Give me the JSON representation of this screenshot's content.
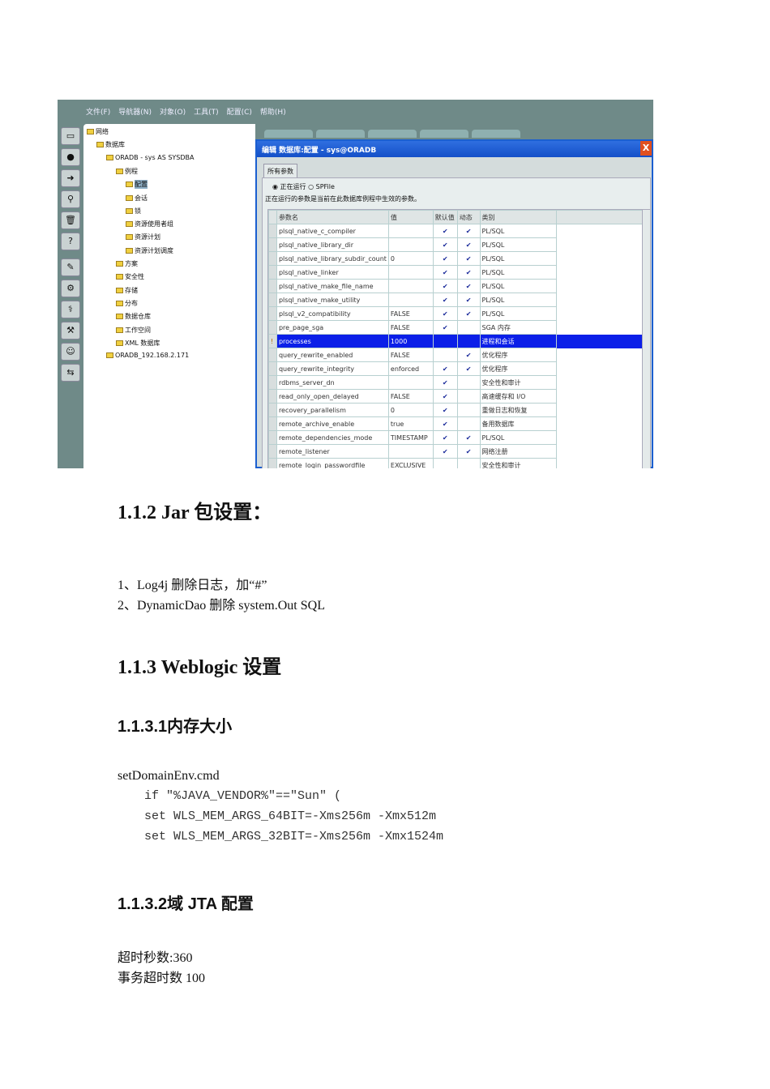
{
  "screenshot": {
    "menu": [
      "文件(F)",
      "导航器(N)",
      "对象(O)",
      "工具(T)",
      "配置(C)",
      "帮助(H)"
    ],
    "tree": [
      {
        "label": "网络",
        "level": 0
      },
      {
        "label": "数据库",
        "level": 1
      },
      {
        "label": "ORADB - sys AS SYSDBA",
        "level": 2
      },
      {
        "label": "例程",
        "level": 3
      },
      {
        "label": "配置",
        "level": 4,
        "selected": true
      },
      {
        "label": "会话",
        "level": 4
      },
      {
        "label": "锁",
        "level": 4
      },
      {
        "label": "资源使用者组",
        "level": 4
      },
      {
        "label": "资源计划",
        "level": 4
      },
      {
        "label": "资源计划调度",
        "level": 4
      },
      {
        "label": "方案",
        "level": 3
      },
      {
        "label": "安全性",
        "level": 3
      },
      {
        "label": "存储",
        "level": 3
      },
      {
        "label": "分布",
        "level": 3
      },
      {
        "label": "数据仓库",
        "level": 3
      },
      {
        "label": "工作空间",
        "level": 3
      },
      {
        "label": "XML 数据库",
        "level": 3
      },
      {
        "label": "ORADB_192.168.2.171",
        "level": 2
      }
    ],
    "dialog": {
      "title": "编辑 数据库:配置 - sys@ORADB",
      "close": "X",
      "tab": "所有参数",
      "radio_running": "正在运行",
      "radio_spfile": "SPFile",
      "description": "正在运行的参数是当前在此数据库例程中生效的参数。",
      "columns": [
        "参数名",
        "值",
        "默认值",
        "动态",
        "类别"
      ],
      "rows": [
        [
          "plsql_native_c_compiler",
          "",
          true,
          true,
          "PL/SQL"
        ],
        [
          "plsql_native_library_dir",
          "",
          true,
          true,
          "PL/SQL"
        ],
        [
          "plsql_native_library_subdir_count",
          "0",
          true,
          true,
          "PL/SQL"
        ],
        [
          "plsql_native_linker",
          "",
          true,
          true,
          "PL/SQL"
        ],
        [
          "plsql_native_make_file_name",
          "",
          true,
          true,
          "PL/SQL"
        ],
        [
          "plsql_native_make_utility",
          "",
          true,
          true,
          "PL/SQL"
        ],
        [
          "plsql_v2_compatibility",
          "FALSE",
          true,
          true,
          "PL/SQL"
        ],
        [
          "pre_page_sga",
          "FALSE",
          true,
          false,
          "SGA 内存"
        ],
        [
          "processes",
          "1000",
          false,
          false,
          "进程和会话"
        ],
        [
          "query_rewrite_enabled",
          "FALSE",
          false,
          true,
          "优化程序"
        ],
        [
          "query_rewrite_integrity",
          "enforced",
          true,
          true,
          "优化程序"
        ],
        [
          "rdbms_server_dn",
          "",
          true,
          false,
          "安全性和审计"
        ],
        [
          "read_only_open_delayed",
          "FALSE",
          true,
          false,
          "高速缓存和 I/O"
        ],
        [
          "recovery_parallelism",
          "0",
          true,
          false,
          "重做日志和恢复"
        ],
        [
          "remote_archive_enable",
          "true",
          true,
          false,
          "备用数据库"
        ],
        [
          "remote_dependencies_mode",
          "TIMESTAMP",
          true,
          true,
          "PL/SQL"
        ],
        [
          "remote_listener",
          "",
          true,
          true,
          "网络注册"
        ],
        [
          "remote_login_passwordfile",
          "EXCLUSIVE",
          false,
          false,
          "安全性和审计"
        ]
      ],
      "selected_row": 8
    }
  },
  "doc": {
    "h_112": "1.1.2 Jar 包设置：",
    "item1": "1、Log4j 删除日志，加“#”",
    "item2": "2、DynamicDao 删除 system.Out SQL",
    "h_113": "1.1.3 Weblogic 设置",
    "h_1131": "1.1.3.1内存大小",
    "file": "setDomainEnv.cmd",
    "code": [
      "if \"%JAVA_VENDOR%\"==\"Sun\" (",
      "set WLS_MEM_ARGS_64BIT=-Xms256m -Xmx512m",
      "set WLS_MEM_ARGS_32BIT=-Xms256m -Xmx1524m"
    ],
    "h_1132": "1.1.3.2域 JTA 配置",
    "timeout_secs": "超时秒数:360",
    "tx_timeout": "事务超时数 100"
  }
}
